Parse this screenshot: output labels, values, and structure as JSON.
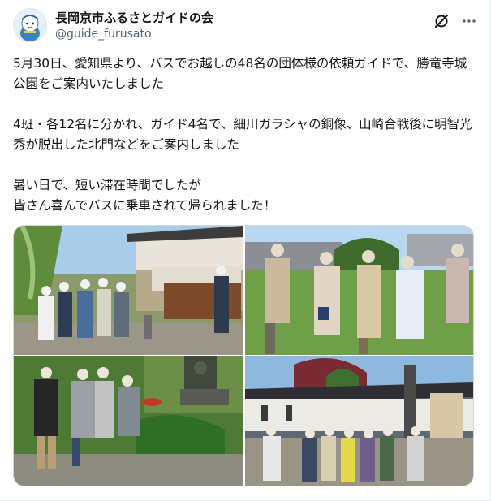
{
  "account": {
    "display_name": "長岡京市ふるさとガイドの会",
    "handle": "@guide_furusato",
    "avatar_icon": "mascot-avatar-icon"
  },
  "actions": {
    "grok_icon": "slash-circle-icon",
    "more_icon": "more-horizontal-icon"
  },
  "post": {
    "paragraphs": [
      "5月30日、愛知県より、バスでお越しの48名の団体様の依頼ガイドで、勝竜寺城公園をご案内いたしました",
      "4班・各12名に分かれ、ガイド4名で、細川ガラシャの銅像、山崎合戦後に明智光秀が脱出した北門などをご案内しました",
      "暑い日で、短い滞在時間でしたが\n皆さん喜んでバスに乗車されて帰られました！"
    ]
  },
  "colors": {
    "text": "#0f1419",
    "secondary_text": "#536471",
    "border": "#cfd9de"
  }
}
